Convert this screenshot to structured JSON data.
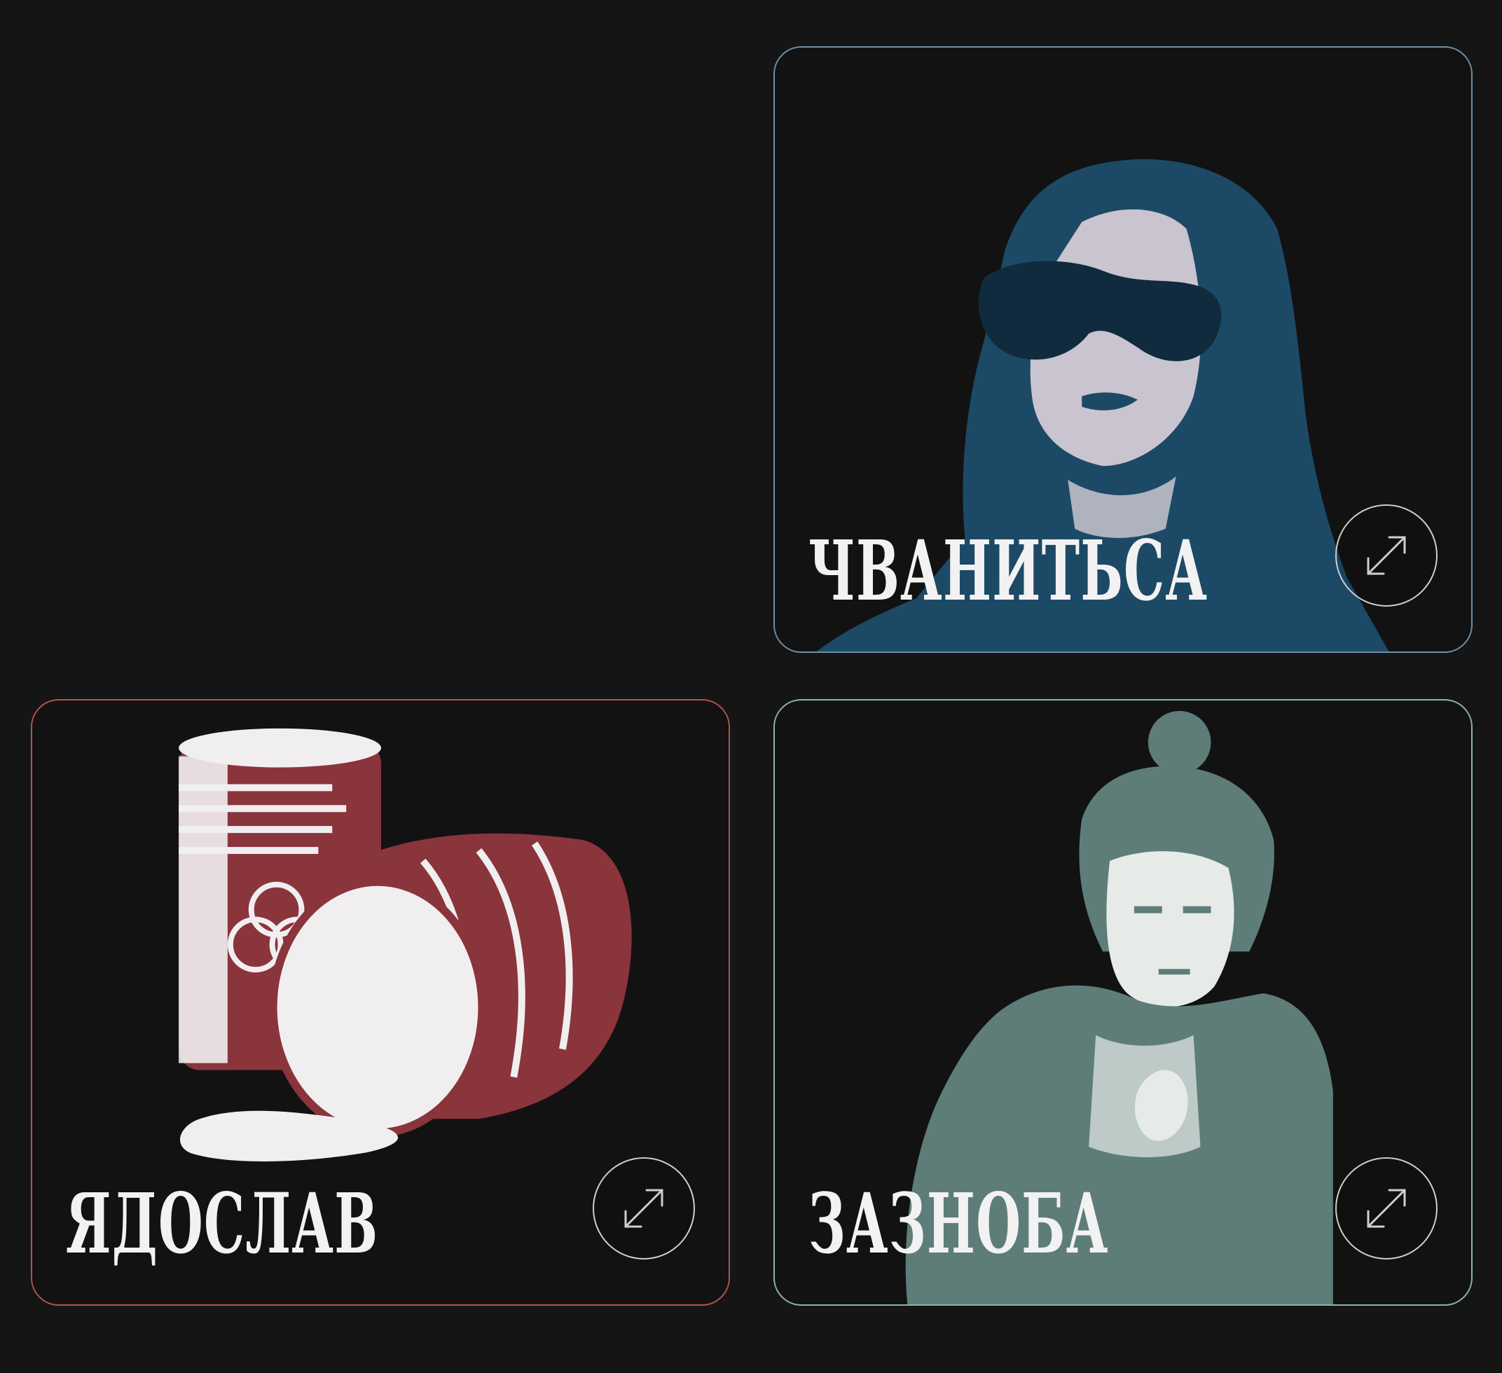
{
  "cards": [
    {
      "title": "Чванитьса",
      "accent": "#6e8fa6",
      "art_color": "#1c4a66",
      "art_light": "#c9c4cf",
      "art_subject": "portrait-woman-sunglasses",
      "icon": "expand-arrows-icon"
    },
    {
      "title": "Ядослав",
      "accent": "#b5524f",
      "art_color": "#8a343c",
      "art_light": "#f1eef0",
      "art_subject": "toxic-barrels",
      "icon": "expand-arrows-icon"
    },
    {
      "title": "Зазноба",
      "accent": "#8fb0b0",
      "art_color": "#5e7d78",
      "art_light": "#e6ebe8",
      "art_subject": "portrait-man-hoodie",
      "icon": "expand-arrows-icon"
    }
  ]
}
